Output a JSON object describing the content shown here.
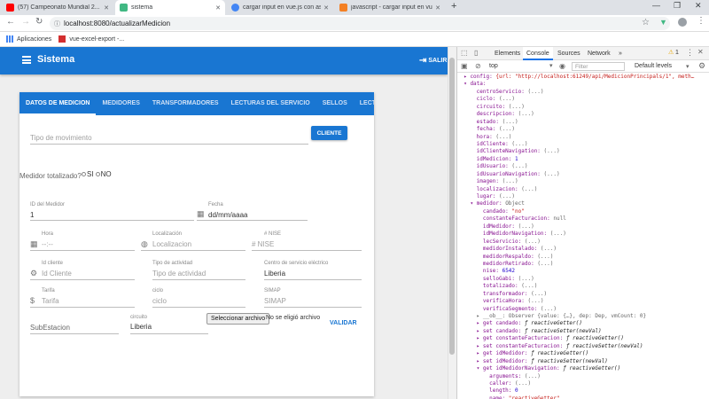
{
  "browser": {
    "tabs": [
      {
        "title": "(57) Campeonato Mundial 2...",
        "fav_color": "#ff0000",
        "active": false
      },
      {
        "title": "sistema",
        "fav_color": "#41b883",
        "active": true
      },
      {
        "title": "cargar input en vue.js con asp.ne...",
        "fav_color": "#4285f4",
        "active": false
      },
      {
        "title": "javascript - cargar input en vue.js...",
        "fav_color": "#f48024",
        "active": false
      }
    ],
    "new_tab": "+",
    "url": "localhost:8080/actualizarMedicion",
    "bookmarks": [
      "Aplicaciones",
      "vue-excel-export -..."
    ]
  },
  "app": {
    "title": "Sistema",
    "salir": "SALIR",
    "tabs": [
      "DATOS DE MEDICION",
      "MEDIDORES",
      "TRANSFORMADORES",
      "LECTURAS DEL SERVICIO",
      "SELLOS",
      "LECTURA MEDIDOR INSTA"
    ],
    "tipo_movimiento_placeholder": "Tipo de movimiento",
    "cliente_button": "CLIENTE",
    "medidor_totalizado_label": "Medidor totalizado?",
    "si_label": "SI",
    "no_label": "NO",
    "id_medidor": {
      "label": "ID del Medidor",
      "value": "1"
    },
    "fecha": {
      "label": "Fecha",
      "placeholder": "dd/mm/aaaa"
    },
    "hora": {
      "label": "Hora",
      "placeholder": "--:--"
    },
    "localizacion": {
      "label": "Localización",
      "placeholder": "Localizacion"
    },
    "nise": {
      "label": "# NISE",
      "placeholder": "# NISE"
    },
    "id_cliente": {
      "label": "Id cliente",
      "placeholder": "Id Cliente"
    },
    "tipo_actividad": {
      "label": "Tipo de actividad",
      "placeholder": "Tipo de actividad"
    },
    "centro_servicio": {
      "label": "Centro de servicio eléctrico",
      "value": "Liberia"
    },
    "tarifa": {
      "label": "Tarifa",
      "placeholder": "Tarifa"
    },
    "ciclo": {
      "label": "ciclo",
      "placeholder": "ciclo"
    },
    "simap": {
      "label": "SIMAP",
      "placeholder": "SIMAP"
    },
    "subestacion_placeholder": "SubEstacion",
    "circuito": {
      "label": "circuito",
      "value": "Liberia"
    },
    "file_button": "Seleccionar archivo",
    "file_status": "No se eligió archivo",
    "validar": "VALIDAR"
  },
  "devtools": {
    "tabs": [
      "Elements",
      "Console",
      "Sources",
      "Network"
    ],
    "more": "»",
    "warnings": "1",
    "context": "top",
    "filter_placeholder": "Filter",
    "levels": "Default levels",
    "lines": [
      {
        "t": "  ▸ config: {url: \"http://localhost:61249/api/MedicionPrincipals/1\", meth…",
        "c": "k"
      },
      {
        "t": "  ▾ data:",
        "c": "k"
      },
      {
        "t": "      centroServicio: (...)",
        "c": "k"
      },
      {
        "t": "      ciclo: (...)",
        "c": "k"
      },
      {
        "t": "      circuito: (...)",
        "c": "k"
      },
      {
        "t": "      descripcion: (...)",
        "c": "k"
      },
      {
        "t": "      estado: (...)",
        "c": "k"
      },
      {
        "t": "      fecha: (...)",
        "c": "k"
      },
      {
        "t": "      hora: (...)",
        "c": "k"
      },
      {
        "t": "      idCliente: (...)",
        "c": "k"
      },
      {
        "t": "      idClienteNavigation: (...)",
        "c": "k"
      },
      {
        "t": "      idMedicion: 1",
        "c": "k"
      },
      {
        "t": "      idUsuario: (...)",
        "c": "k"
      },
      {
        "t": "      idUsuarioNavigation: (...)",
        "c": "k"
      },
      {
        "t": "      imagen: (...)",
        "c": "k"
      },
      {
        "t": "      localizacion: (...)",
        "c": "k"
      },
      {
        "t": "      lugar: (...)",
        "c": "k"
      },
      {
        "t": "    ▾ medidor: Object",
        "c": "k"
      },
      {
        "t": "        candado: \"no\"",
        "c": "k"
      },
      {
        "t": "        constanteFacturacion: null",
        "c": "k"
      },
      {
        "t": "        idMedidor: (...)",
        "c": "k"
      },
      {
        "t": "        idMedidorNavigation: (...)",
        "c": "k"
      },
      {
        "t": "        lecServicio: (...)",
        "c": "k"
      },
      {
        "t": "        medidorInstalado: (...)",
        "c": "k"
      },
      {
        "t": "        medidorRespaldo: (...)",
        "c": "k"
      },
      {
        "t": "        medidorRetirado: (...)",
        "c": "k"
      },
      {
        "t": "        nise: 6542",
        "c": "k"
      },
      {
        "t": "        selloGabi: (...)",
        "c": "k"
      },
      {
        "t": "        totalizado: (...)",
        "c": "k"
      },
      {
        "t": "        transformador: (...)",
        "c": "k"
      },
      {
        "t": "        verificaHora: (...)",
        "c": "k"
      },
      {
        "t": "        verificaSegmento: (...)",
        "c": "k"
      },
      {
        "t": "      ▸ __ob__: Observer {value: {…}, dep: Dep, vmCount: 0}",
        "c": "g"
      },
      {
        "t": "      ▸ get candado: ƒ reactiveGetter()",
        "c": "k"
      },
      {
        "t": "      ▸ set candado: ƒ reactiveSetter(newVal)",
        "c": "k"
      },
      {
        "t": "      ▸ get constanteFacturacion: ƒ reactiveGetter()",
        "c": "k"
      },
      {
        "t": "      ▸ set constanteFacturacion: ƒ reactiveSetter(newVal)",
        "c": "k"
      },
      {
        "t": "      ▸ get idMedidor: ƒ reactiveGetter()",
        "c": "k"
      },
      {
        "t": "      ▸ set idMedidor: ƒ reactiveSetter(newVal)",
        "c": "k"
      },
      {
        "t": "      ▾ get idMedidorNavigation: ƒ reactiveGetter()",
        "c": "k"
      },
      {
        "t": "          arguments: (...)",
        "c": "k"
      },
      {
        "t": "          caller: (...)",
        "c": "k"
      },
      {
        "t": "          length: 0",
        "c": "k"
      },
      {
        "t": "          name: \"reactiveGetter\"",
        "c": "k"
      }
    ]
  }
}
